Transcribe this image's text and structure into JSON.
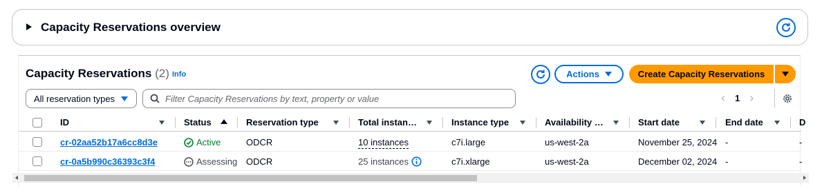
{
  "overview": {
    "title": "Capacity Reservations overview"
  },
  "header": {
    "title": "Capacity Reservations",
    "count": "(2)",
    "info": "Info",
    "actions_label": "Actions",
    "create_label": "Create Capacity Reservations"
  },
  "filters": {
    "type_select": "All reservation types",
    "search_placeholder": "Filter Capacity Reservations by text, property or value"
  },
  "pagination": {
    "current_page": "1"
  },
  "table": {
    "columns": [
      "ID",
      "Status",
      "Reservation type",
      "Total instan…",
      "Instance type",
      "Availability …",
      "Start date",
      "End date",
      "D"
    ],
    "rows": [
      {
        "id": "cr-02aa52b17a6cc8d3e",
        "status": "Active",
        "reservation_type": "ODCR",
        "total_instances": "10 instances",
        "instance_type": "c7i.large",
        "availability_zone": "us-west-2a",
        "start_date": "November 25, 2024",
        "end_date": "-",
        "d": "-"
      },
      {
        "id": "cr-0a5b990c36393c3f4",
        "status": "Assessing",
        "reservation_type": "ODCR",
        "total_instances": "25 instances",
        "instance_type": "c7i.xlarge",
        "availability_zone": "us-west-2a",
        "start_date": "December 02, 2024",
        "end_date": "-",
        "d": "-"
      }
    ]
  },
  "colors": {
    "accent": "#006ce0",
    "primary_button": "#ff9900",
    "success": "#00802f",
    "text": "#000716"
  }
}
